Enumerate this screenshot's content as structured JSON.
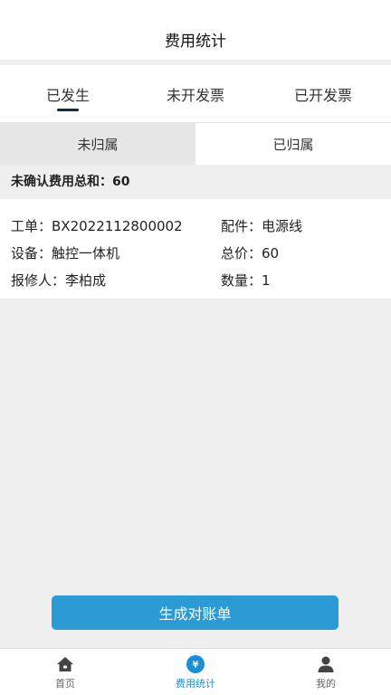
{
  "header": {
    "title": "费用统计"
  },
  "tabs": [
    {
      "label": "已发生",
      "active": true
    },
    {
      "label": "未开发票",
      "active": false
    },
    {
      "label": "已开发票",
      "active": false
    }
  ],
  "subtabs": [
    {
      "label": "未归属",
      "active": true
    },
    {
      "label": "已归属",
      "active": false
    }
  ],
  "summary": {
    "text": "未确认费用总和：60"
  },
  "record": {
    "order": "工单：BX2022112800002",
    "part": "配件：电源线",
    "device": "设备：触控一体机",
    "total": "总价：60",
    "reporter": "报修人：李柏成",
    "quantity": "数量：1"
  },
  "generate_button": {
    "label": "生成对账单"
  },
  "tabbar": [
    {
      "label": "首页",
      "icon": "home-icon",
      "active": false
    },
    {
      "label": "费用统计",
      "icon": "yen-icon",
      "active": true
    },
    {
      "label": "我的",
      "icon": "user-icon",
      "active": false
    }
  ],
  "colors": {
    "accent": "#1a8fd6",
    "button": "#2a9bd4",
    "underline": "#1e2a3a"
  }
}
